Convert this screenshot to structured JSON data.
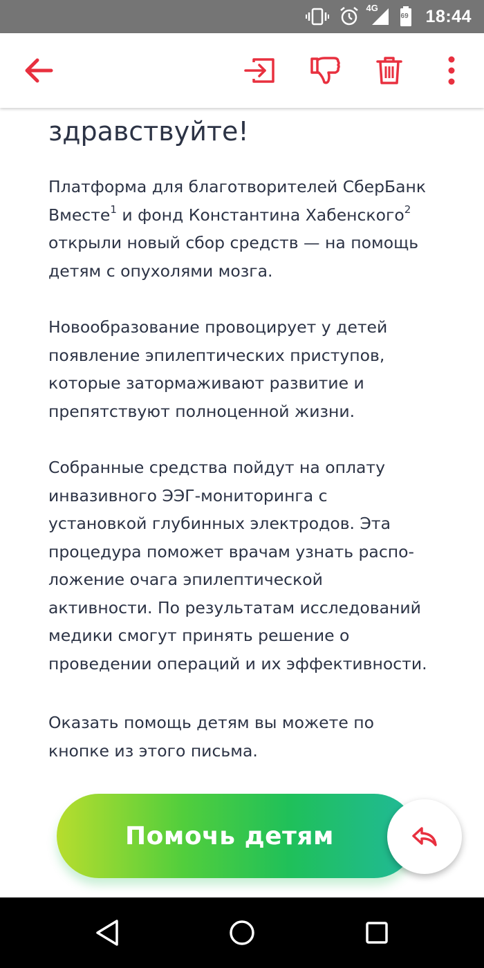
{
  "status_bar": {
    "network": "4G",
    "battery": "69",
    "time": "18:44",
    "icons": [
      "vibrate-icon",
      "alarm-icon",
      "signal-icon",
      "battery-icon"
    ]
  },
  "toolbar": {
    "icons": [
      "back-arrow-icon",
      "move-to-folder-icon",
      "thumbs-down-icon",
      "trash-icon",
      "more-vert-icon"
    ],
    "accent_color": "#e8303f"
  },
  "email": {
    "greeting": "здравствуйте!",
    "p1": {
      "line1": "Платформа для благотворителей СберБанк",
      "line2_a": "Вместе",
      "line2_sup1": "1",
      "line2_b": " и фонд Константина Хабенского",
      "line2_sup2": "2",
      "line3": "открыли новый сбор средств — на помощь",
      "line4": "детям с опухолями мозга."
    },
    "p2": [
      "Новообразование провоцирует у детей",
      "появление эпилептических приступов,",
      "которые затормаживают развитие и",
      "препятствуют полноценной жизни."
    ],
    "p3": [
      "Собранные средства пойдут на оплату",
      "инвазивного ЭЭГ-мониторинга с",
      "установкой глубинных электродов. Эта",
      "процедура поможет врачам узнать распо-",
      "ложение очага эпилептической",
      "активности. По результатам исследований",
      "медики смогут принять решение о",
      "проведении операций и их эффективности."
    ],
    "p4": [
      "Оказать помощь детям вы можете по",
      "кнопке из этого письма."
    ],
    "cta_label": "Помочь детям"
  },
  "nav_bar": {
    "icons": [
      "nav-back-icon",
      "nav-home-icon",
      "nav-recent-icon"
    ]
  }
}
